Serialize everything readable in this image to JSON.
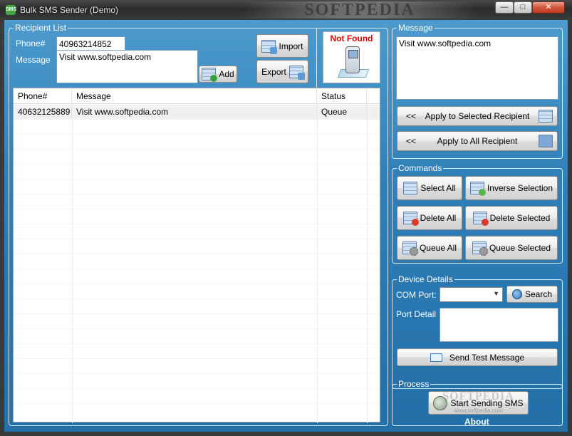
{
  "window": {
    "title": "Bulk SMS Sender (Demo)",
    "icon_text": "SMS",
    "watermark": "SOFTPEDIA",
    "min_glyph": "—",
    "max_glyph": "□",
    "close_glyph": "✕"
  },
  "recipient_list": {
    "legend": "Recipient List",
    "phone_label": "Phone#",
    "phone_value": "40963214852",
    "message_label": "Message",
    "message_value": "Visit www.softpedia.com",
    "add_label": "Add",
    "import_label": "Import",
    "export_label": "Export",
    "device_status": "Not Found",
    "table": {
      "columns": [
        "Phone#",
        "Message",
        "Status"
      ],
      "rows": [
        {
          "phone": "40632125889",
          "message": "Visit www.softpedia.com",
          "status": "Queue"
        }
      ]
    }
  },
  "message_panel": {
    "legend": "Message",
    "text": "Visit www.softpedia.com",
    "apply_selected_label": "Apply to Selected Recipient",
    "apply_all_label": "Apply to All Recipient",
    "arrow_glyph": "<<"
  },
  "commands": {
    "legend": "Commands",
    "select_all": "Select All",
    "inverse_selection": "Inverse Selection",
    "delete_all": "Delete All",
    "delete_selected": "Delete Selected",
    "queue_all": "Queue All",
    "queue_selected": "Queue Selected"
  },
  "device": {
    "legend": "Device Details",
    "com_port_label": "COM Port:",
    "com_port_value": "",
    "search_label": "Search",
    "port_detail_label": "Port Detail",
    "port_detail_value": "",
    "send_test_label": "Send Test Message"
  },
  "process": {
    "legend": "Process",
    "start_label": "Start Sending SMS",
    "watermark": "SOFTPEDIA",
    "watermark_small": "www.softpedia.com",
    "about_label": "About"
  },
  "colors": {
    "panel_blue": "#2f7fb8",
    "not_found_red": "#e20000"
  }
}
